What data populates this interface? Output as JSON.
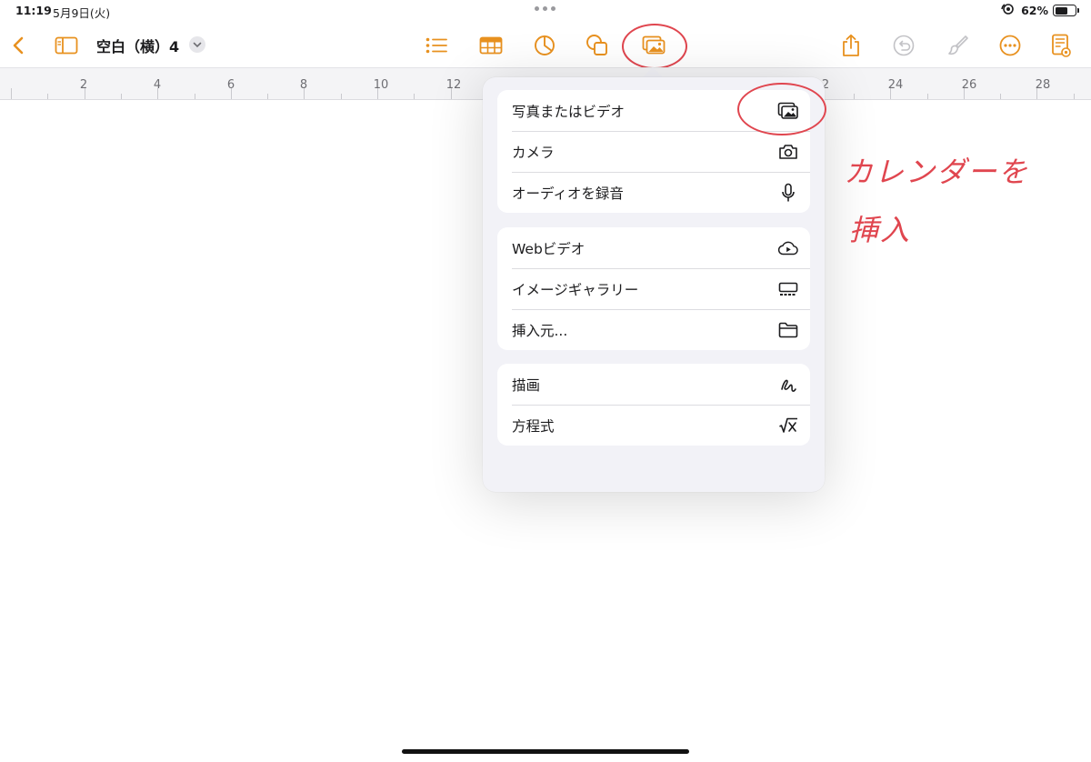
{
  "status_bar": {
    "time": "11:19",
    "date": "5月9日(火)",
    "battery": "62%"
  },
  "toolbar": {
    "title": "空白（横）4",
    "icons": [
      "back-chevron-icon",
      "sidebar-icon",
      "list-icon",
      "table-icon",
      "chart-icon",
      "shapes-icon",
      "media-icon",
      "share-icon",
      "undo-icon",
      "paintbrush-icon",
      "more-icon",
      "document-view-icon"
    ]
  },
  "ruler": {
    "labels": [
      "2",
      "4",
      "6",
      "8",
      "10",
      "12",
      "",
      "",
      "2",
      "24",
      "26",
      "28"
    ]
  },
  "menu": {
    "groups": [
      {
        "items": [
          {
            "label": "写真またはビデオ",
            "icon": "photo-library-icon"
          },
          {
            "label": "カメラ",
            "icon": "camera-icon"
          },
          {
            "label": "オーディオを録音",
            "icon": "microphone-icon"
          }
        ]
      },
      {
        "items": [
          {
            "label": "Webビデオ",
            "icon": "web-video-icon"
          },
          {
            "label": "イメージギャラリー",
            "icon": "image-gallery-icon"
          },
          {
            "label": "挿入元...",
            "icon": "folder-icon"
          }
        ]
      },
      {
        "items": [
          {
            "label": "描画",
            "icon": "drawing-icon"
          },
          {
            "label": "方程式",
            "icon": "equation-icon"
          }
        ]
      }
    ]
  },
  "annotation": {
    "line1": "カレンダーを",
    "line2": "挿入",
    "color": "#e0464f"
  },
  "colors": {
    "accent": "#e8911f",
    "annotation": "#e0464f"
  }
}
